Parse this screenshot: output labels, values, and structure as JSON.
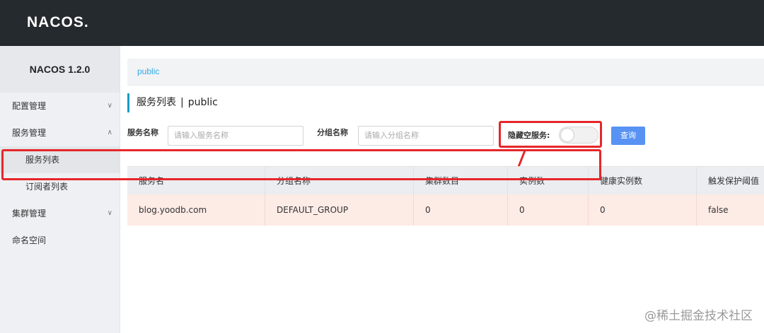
{
  "header": {
    "logo": "NACOS."
  },
  "sidebar": {
    "version": "NACOS 1.2.0",
    "items": [
      {
        "label": "配置管理",
        "chevron": "chevron-down-icon"
      },
      {
        "label": "服务管理",
        "chevron": "chevron-up-icon"
      },
      {
        "label": "服务列表"
      },
      {
        "label": "订阅者列表"
      },
      {
        "label": "集群管理",
        "chevron": "chevron-down-icon"
      },
      {
        "label": "命名空间"
      }
    ]
  },
  "namespace": {
    "current": "public"
  },
  "page": {
    "title": "服务列表",
    "separator": "|",
    "namespace": "public"
  },
  "filters": {
    "service_name_label": "服务名称",
    "service_name_placeholder": "请输入服务名称",
    "group_name_label": "分组名称",
    "group_name_placeholder": "请输入分组名称",
    "hide_empty_label": "隐藏空服务:",
    "query_button": "查询"
  },
  "table": {
    "columns": [
      "服务名",
      "分组名称",
      "集群数目",
      "实例数",
      "健康实例数",
      "触发保护阈值"
    ],
    "rows": [
      [
        "blog.yoodb.com",
        "DEFAULT_GROUP",
        "0",
        "0",
        "0",
        "false"
      ]
    ]
  },
  "watermark": "@稀土掘金技术社区",
  "colors": {
    "topbar": "#252a2f",
    "accent": "#1b9ac7",
    "button": "#5893f4",
    "highlight": "#e6262a"
  }
}
